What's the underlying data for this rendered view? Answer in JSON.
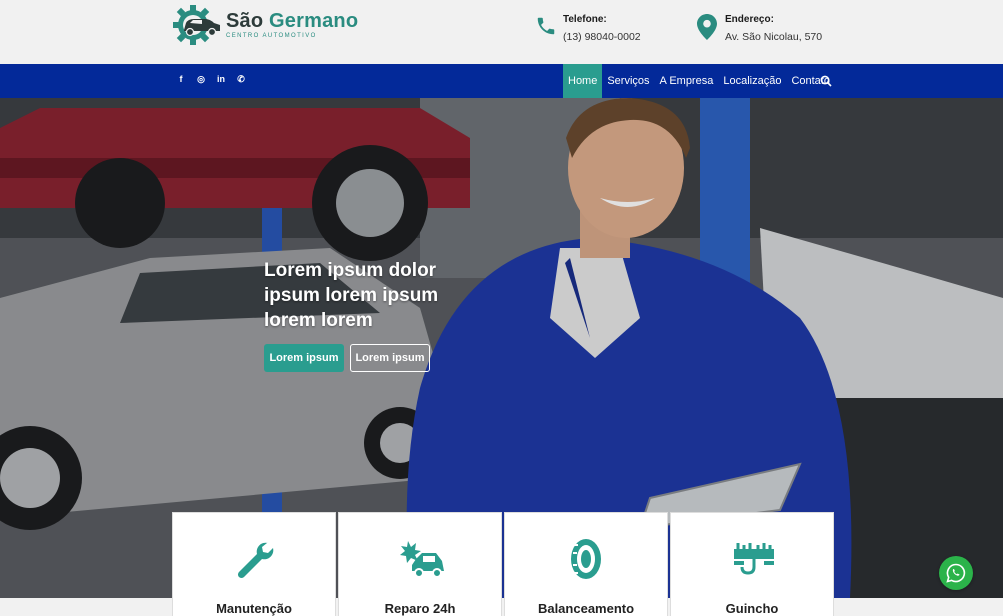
{
  "brand": {
    "name_part1": "São",
    "name_part2": "Germano",
    "tagline": "CENTRO AUTOMOTIVO"
  },
  "contacts": [
    {
      "label": "Telefone:",
      "value": "(13) 98040-0002",
      "icon": "phone-icon"
    },
    {
      "label": "Endereço:",
      "value": "Av. São Nicolau, 570",
      "icon": "map-pin-icon"
    }
  ],
  "social": [
    {
      "glyph": "f",
      "icon": "facebook-icon"
    },
    {
      "glyph": "◎",
      "icon": "instagram-icon"
    },
    {
      "glyph": "in",
      "icon": "linkedin-icon"
    },
    {
      "glyph": "✆",
      "icon": "whatsapp-icon"
    }
  ],
  "menu": [
    {
      "label": "Home",
      "active": true
    },
    {
      "label": "Serviços",
      "active": false
    },
    {
      "label": "A Empresa",
      "active": false
    },
    {
      "label": "Localização",
      "active": false
    },
    {
      "label": "Contato",
      "active": false
    }
  ],
  "hero": {
    "title": "Lorem ipsum dolor ipsum lorem ipsum lorem lorem",
    "primary_button": "Lorem ipsum",
    "secondary_button": "Lorem ipsum"
  },
  "services": [
    {
      "title": "Manutenção",
      "icon": "wrench-icon"
    },
    {
      "title": "Reparo 24h",
      "icon": "car-crash-icon"
    },
    {
      "title": "Balanceamento",
      "icon": "tire-icon"
    },
    {
      "title": "Guincho",
      "icon": "tow-hook-icon"
    }
  ],
  "colors": {
    "accent": "#2a9d8f",
    "navbar": "#032999",
    "whatsapp": "#2bb34a"
  }
}
